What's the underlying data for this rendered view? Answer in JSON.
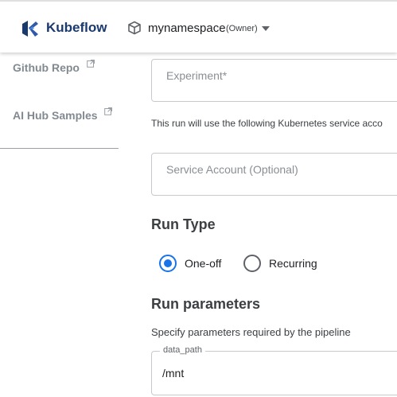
{
  "header": {
    "brand": "Kubeflow",
    "namespace": "mynamespace",
    "namespace_role": "(Owner)"
  },
  "sidebar": {
    "items": [
      {
        "label": "Github Repo",
        "icon": "external-link-icon"
      },
      {
        "label": "AI Hub Samples",
        "icon": "external-link-icon"
      }
    ]
  },
  "form": {
    "experiment_placeholder": "Experiment*",
    "service_account_helper": "This run will use the following Kubernetes service acco",
    "service_account_placeholder": "Service Account (Optional)",
    "run_type_title": "Run Type",
    "run_type_options": [
      {
        "label": "One-off",
        "selected": true
      },
      {
        "label": "Recurring",
        "selected": false
      }
    ],
    "run_parameters_title": "Run parameters",
    "run_parameters_desc": "Specify parameters required by the pipeline",
    "parameters": [
      {
        "name": "data_path",
        "value": "/mnt"
      }
    ]
  },
  "colors": {
    "accent": "#1a73e8",
    "brand": "#1a3a6e"
  }
}
